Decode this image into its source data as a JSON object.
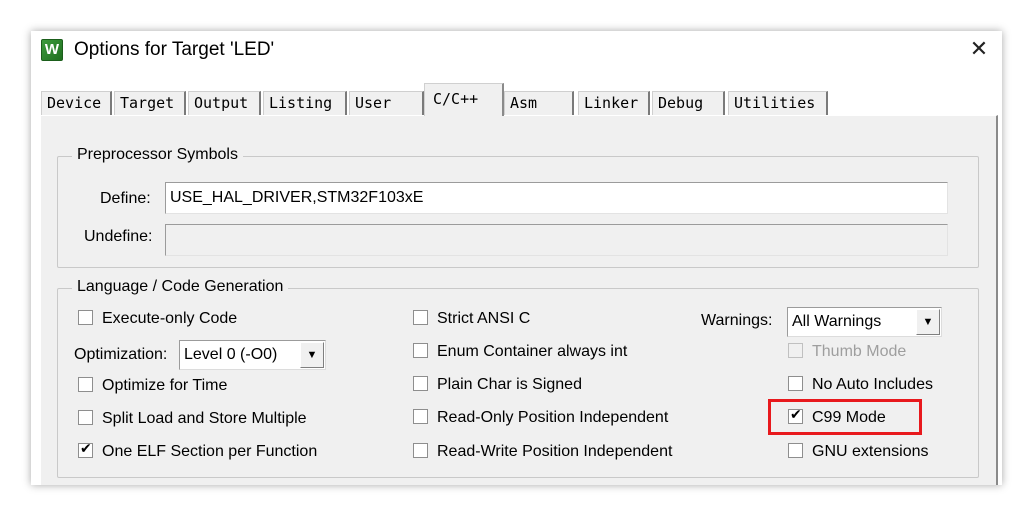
{
  "window": {
    "title": "Options for Target 'LED'",
    "icon_letter": "W",
    "close_glyph": "✕"
  },
  "tabs": [
    {
      "label": "Device"
    },
    {
      "label": "Target"
    },
    {
      "label": "Output"
    },
    {
      "label": "Listing"
    },
    {
      "label": "User"
    },
    {
      "label": "C/C++"
    },
    {
      "label": "Asm"
    },
    {
      "label": "Linker"
    },
    {
      "label": "Debug"
    },
    {
      "label": "Utilities"
    }
  ],
  "active_tab": "C/C++",
  "preprocessor": {
    "title": "Preprocessor Symbols",
    "define_label": "Define:",
    "define_value": "USE_HAL_DRIVER,STM32F103xE",
    "undefine_label": "Undefine:",
    "undefine_value": ""
  },
  "language": {
    "title": "Language / Code Generation",
    "execute_only": {
      "label": "Execute-only Code",
      "checked": false
    },
    "optimization_label": "Optimization:",
    "optimization_value": "Level 0 (-O0)",
    "optimize_time": {
      "label": "Optimize for Time",
      "checked": false
    },
    "split_load": {
      "label": "Split Load and Store Multiple",
      "checked": false
    },
    "one_elf": {
      "label": "One ELF Section per Function",
      "checked": true
    },
    "strict_ansi": {
      "label": "Strict ANSI C",
      "checked": false
    },
    "enum_container": {
      "label": "Enum Container always int",
      "checked": false
    },
    "plain_char": {
      "label": "Plain Char is Signed",
      "checked": false
    },
    "ro_pi": {
      "label": "Read-Only Position Independent",
      "checked": false
    },
    "rw_pi": {
      "label": "Read-Write Position Independent",
      "checked": false
    },
    "warnings_label": "Warnings:",
    "warnings_value": "All Warnings",
    "thumb_mode": {
      "label": "Thumb Mode",
      "checked": false,
      "disabled": true
    },
    "no_auto_includes": {
      "label": "No Auto Includes",
      "checked": false
    },
    "c99_mode": {
      "label": "C99 Mode",
      "checked": true
    },
    "gnu_extensions": {
      "label": "GNU extensions",
      "checked": false
    }
  },
  "colors": {
    "highlight": "#e8191d",
    "panel": "#f0f0f0"
  },
  "icons": {
    "dropdown": "▼"
  }
}
